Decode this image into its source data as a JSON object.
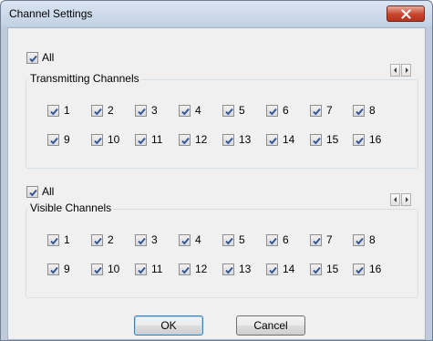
{
  "window": {
    "title": "Channel Settings"
  },
  "transmitting": {
    "all_label": "All",
    "group_title": "Transmitting Channels",
    "channels": [
      "1",
      "2",
      "3",
      "4",
      "5",
      "6",
      "7",
      "8",
      "9",
      "10",
      "11",
      "12",
      "13",
      "14",
      "15",
      "16"
    ],
    "checked": true
  },
  "visible": {
    "all_label": "All",
    "group_title": "Visible Channels",
    "channels": [
      "1",
      "2",
      "3",
      "4",
      "5",
      "6",
      "7",
      "8",
      "9",
      "10",
      "11",
      "12",
      "13",
      "14",
      "15",
      "16"
    ],
    "checked": true
  },
  "buttons": {
    "ok": "OK",
    "cancel": "Cancel"
  },
  "icons": {
    "close": "close-icon",
    "checkmark": "checkmark-icon",
    "scroll_left": "arrow-left-icon",
    "scroll_right": "arrow-right-icon"
  }
}
